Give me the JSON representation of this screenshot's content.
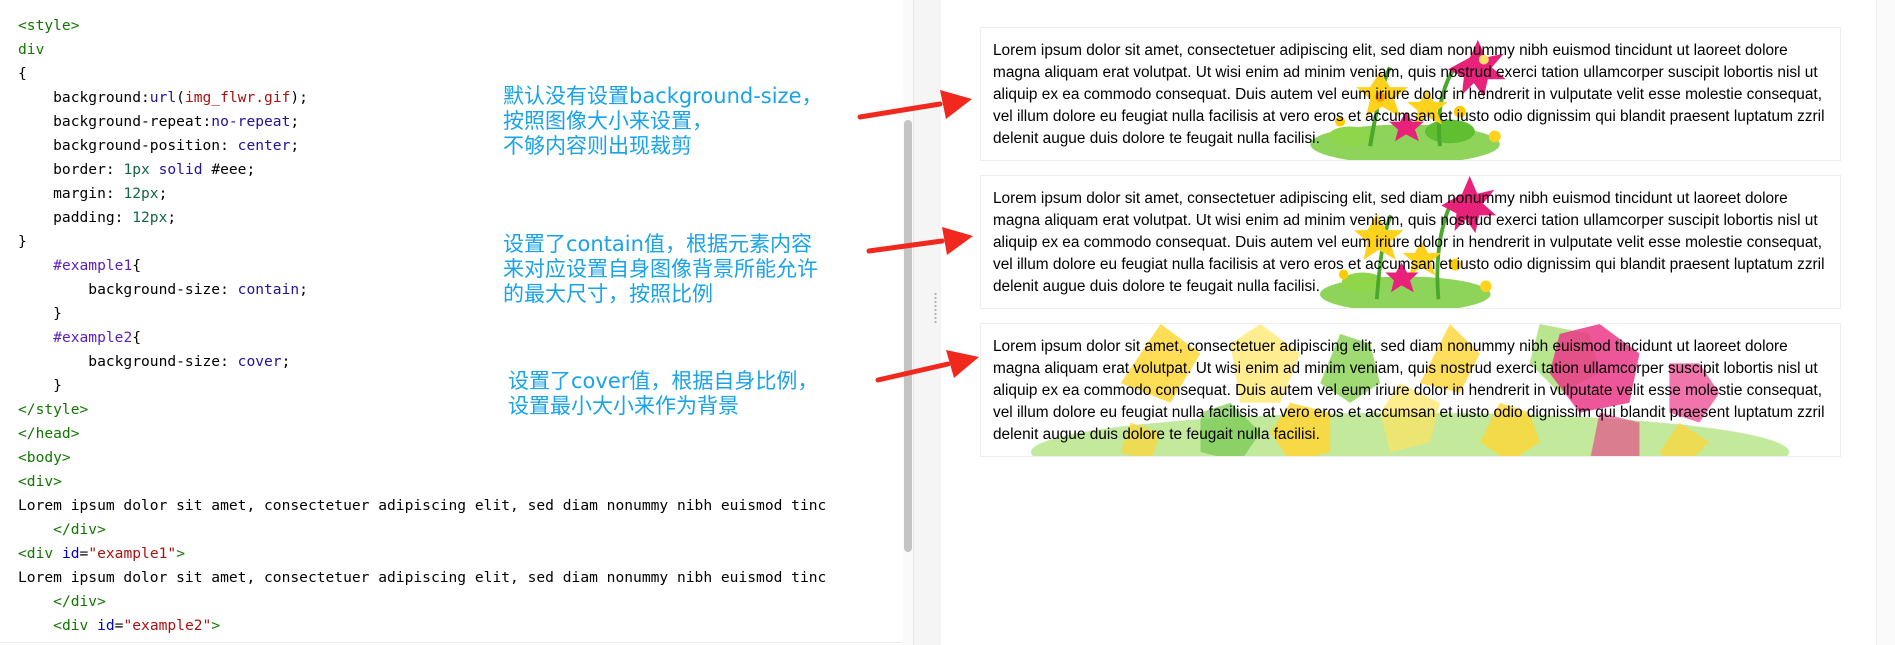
{
  "editor": {
    "code_lines": [
      [
        {
          "t": "<style>",
          "c": "tag"
        }
      ],
      [
        {
          "t": "div",
          "c": "sel"
        }
      ],
      [
        {
          "t": "{",
          "c": ""
        }
      ],
      [
        {
          "t": "    background:",
          "c": ""
        },
        {
          "t": "url",
          "c": "kw"
        },
        {
          "t": "(",
          "c": ""
        },
        {
          "t": "img_flwr.gif",
          "c": "str"
        },
        {
          "t": ");",
          "c": ""
        }
      ],
      [
        {
          "t": "    background-repeat:",
          "c": ""
        },
        {
          "t": "no-repeat",
          "c": "kw"
        },
        {
          "t": ";",
          "c": ""
        }
      ],
      [
        {
          "t": "    background-position: ",
          "c": ""
        },
        {
          "t": "center",
          "c": "kw"
        },
        {
          "t": ";",
          "c": ""
        }
      ],
      [
        {
          "t": "    border: ",
          "c": ""
        },
        {
          "t": "1px",
          "c": "num"
        },
        {
          "t": " ",
          "c": ""
        },
        {
          "t": "solid",
          "c": "kw"
        },
        {
          "t": " #eee;",
          "c": ""
        }
      ],
      [
        {
          "t": "    margin: ",
          "c": ""
        },
        {
          "t": "12px",
          "c": "num"
        },
        {
          "t": ";",
          "c": ""
        }
      ],
      [
        {
          "t": "    padding: ",
          "c": ""
        },
        {
          "t": "12px",
          "c": "num"
        },
        {
          "t": ";",
          "c": ""
        }
      ],
      [
        {
          "t": "}",
          "c": ""
        }
      ],
      [
        {
          "t": "    ",
          "c": ""
        },
        {
          "t": "#example1",
          "c": "hash"
        },
        {
          "t": "{",
          "c": ""
        }
      ],
      [
        {
          "t": "        background-size: ",
          "c": ""
        },
        {
          "t": "contain",
          "c": "kw"
        },
        {
          "t": ";",
          "c": ""
        }
      ],
      [
        {
          "t": "    }",
          "c": ""
        }
      ],
      [
        {
          "t": "    ",
          "c": ""
        },
        {
          "t": "#example2",
          "c": "hash"
        },
        {
          "t": "{",
          "c": ""
        }
      ],
      [
        {
          "t": "        background-size: ",
          "c": ""
        },
        {
          "t": "cover",
          "c": "kw"
        },
        {
          "t": ";",
          "c": ""
        }
      ],
      [
        {
          "t": "    }",
          "c": ""
        }
      ],
      [
        {
          "t": "</style>",
          "c": "tag"
        }
      ],
      [
        {
          "t": "</head>",
          "c": "tag"
        }
      ],
      [
        {
          "t": "<body>",
          "c": "tag"
        }
      ],
      [
        {
          "t": "<div>",
          "c": "tag"
        }
      ],
      [
        {
          "t": "Lorem ipsum dolor sit amet, consectetuer adipiscing elit, sed diam nonummy nibh euismod tinc",
          "c": ""
        }
      ],
      [
        {
          "t": "    ",
          "c": ""
        },
        {
          "t": "</div>",
          "c": "tag"
        }
      ],
      [
        {
          "t": "<div ",
          "c": "tag"
        },
        {
          "t": "id",
          "c": "attr"
        },
        {
          "t": "=",
          "c": ""
        },
        {
          "t": "\"example1\"",
          "c": "str"
        },
        {
          "t": ">",
          "c": "tag"
        }
      ],
      [
        {
          "t": "Lorem ipsum dolor sit amet, consectetuer adipiscing elit, sed diam nonummy nibh euismod tinc",
          "c": ""
        }
      ],
      [
        {
          "t": "    ",
          "c": ""
        },
        {
          "t": "</div>",
          "c": "tag"
        }
      ],
      [
        {
          "t": "    ",
          "c": ""
        },
        {
          "t": "<div ",
          "c": "tag"
        },
        {
          "t": "id",
          "c": "attr"
        },
        {
          "t": "=",
          "c": ""
        },
        {
          "t": "\"example2\"",
          "c": "str"
        },
        {
          "t": ">",
          "c": "tag"
        }
      ]
    ]
  },
  "annotations": {
    "a1": "默认没有设置background-size，\n按照图像大小来设置，\n不够内容则出现裁剪",
    "a2": "设置了contain值，根据元素内容\n来对应设置自身图像背景所能允许\n的最大尺寸，按照比例",
    "a3": "设置了cover值，根据自身比例，\n设置最小大小来作为背景"
  },
  "preview": {
    "lorem": "Lorem ipsum dolor sit amet, consectetuer adipiscing elit, sed diam nonummy nibh euismod tincidunt ut laoreet dolore magna aliquam erat volutpat. Ut wisi enim ad minim veniam, quis nostrud exerci tation ullamcorper suscipit lobortis nisl ut aliquip ex ea commodo consequat. Duis autem vel eum iriure dolor in hendrerit in vulputate velit esse molestie consequat, vel illum dolore eu feugiat nulla facilisis at vero eros et accumsan et iusto odio dignissim qui blandit praesent luptatum zzril delenit augue duis dolore te feugait nulla facilisi."
  },
  "colors": {
    "annotation": "#19a3e8",
    "arrow": "#f0281e",
    "flower_pink": "#e8227a",
    "flower_yellow": "#ffd21e",
    "leaf_green": "#66c23a"
  }
}
